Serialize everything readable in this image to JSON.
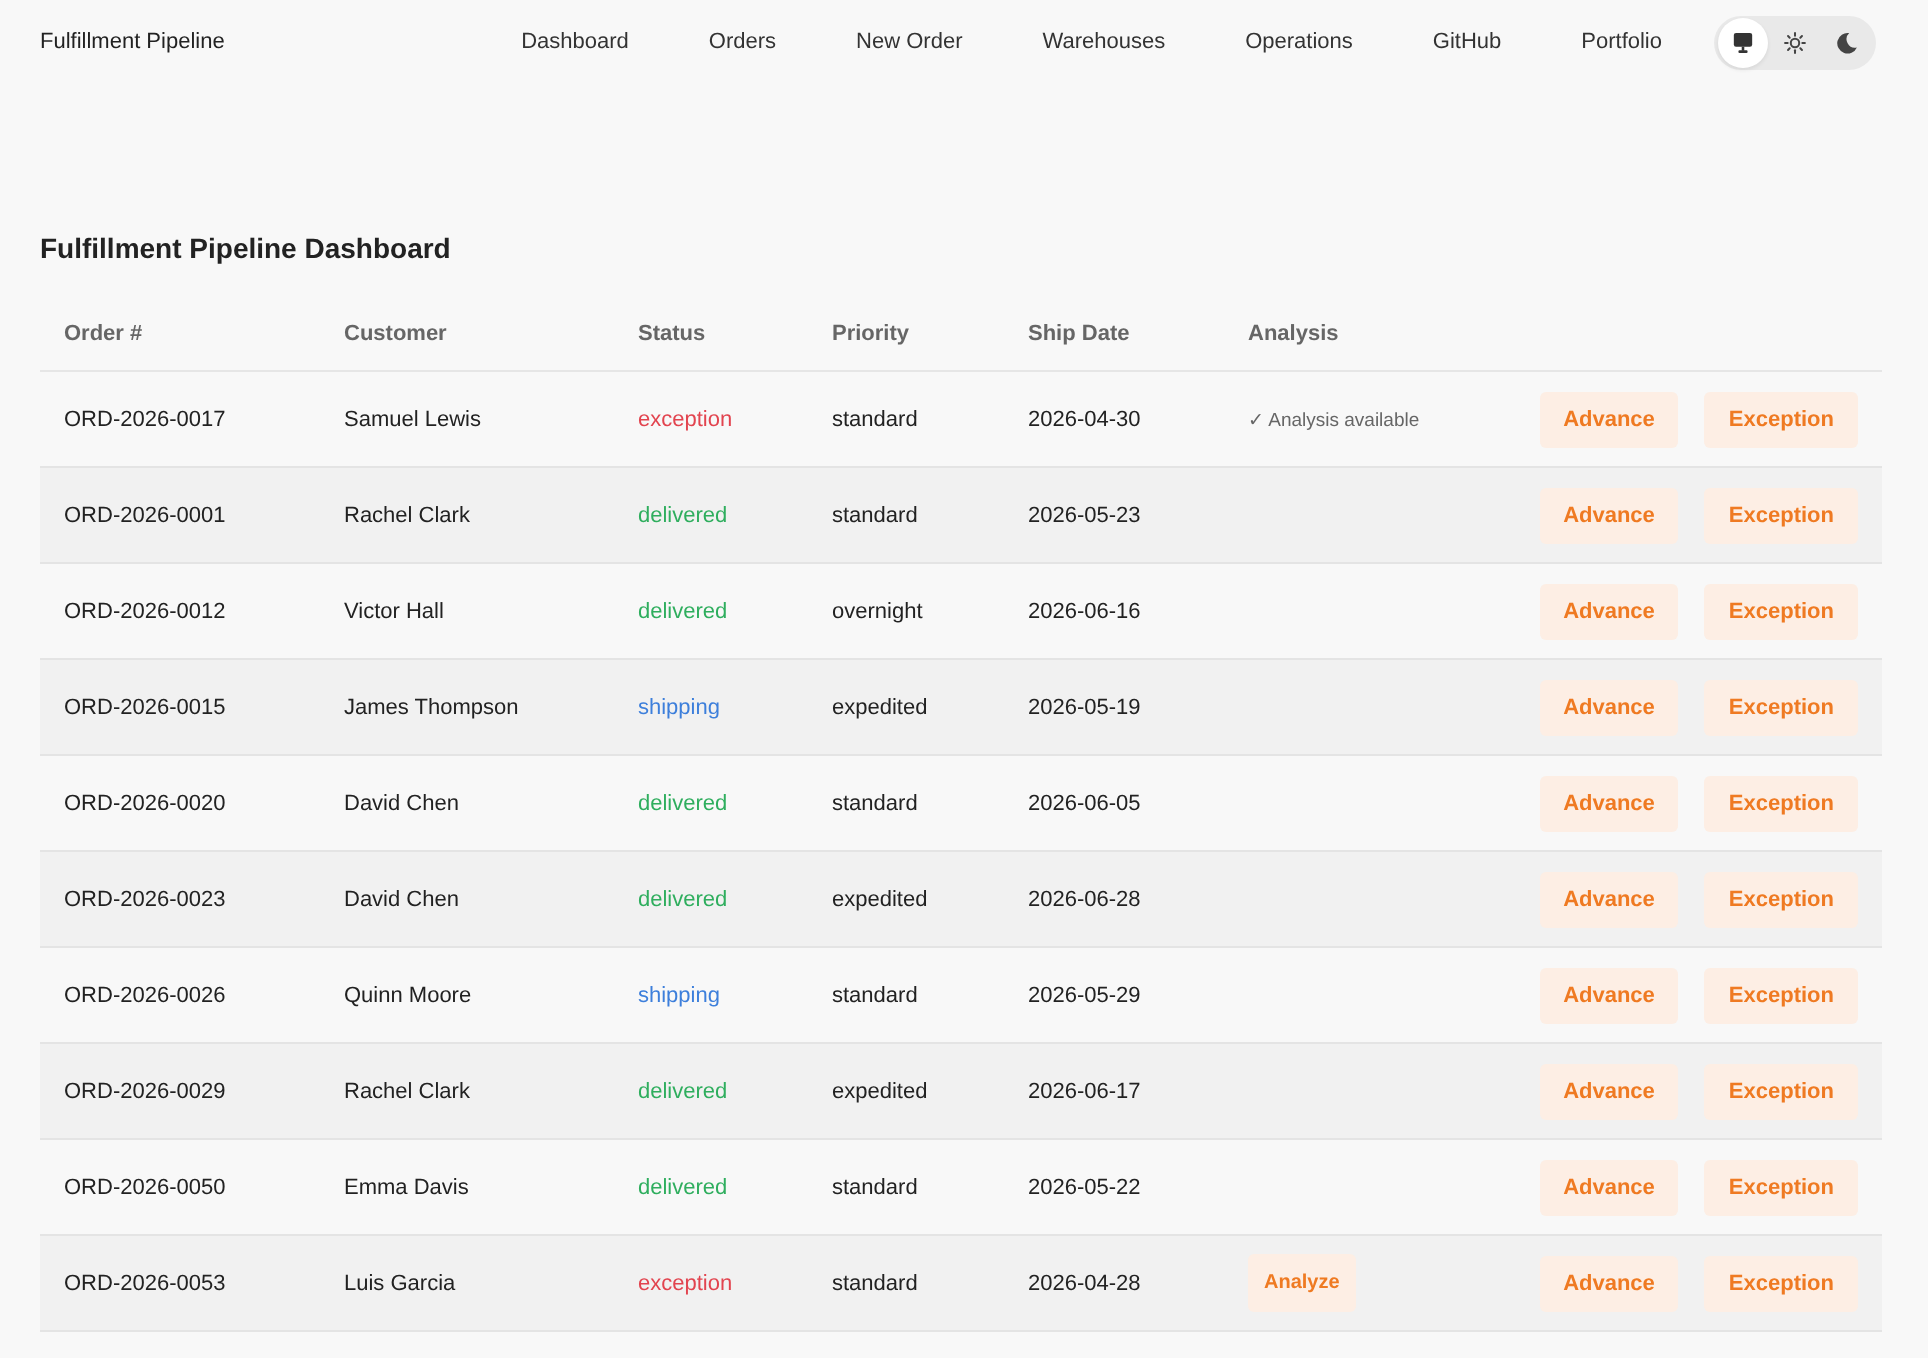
{
  "brand": "Fulfillment Pipeline",
  "nav": [
    "Dashboard",
    "Orders",
    "New Order",
    "Warehouses",
    "Operations",
    "GitHub",
    "Portfolio"
  ],
  "theme_toggle": [
    {
      "kind": "system",
      "selected": true
    },
    {
      "kind": "light",
      "selected": false
    },
    {
      "kind": "dark",
      "selected": false
    }
  ],
  "heading": "Fulfillment Pipeline Dashboard",
  "table": {
    "columns": [
      "Order #",
      "Customer",
      "Status",
      "Priority",
      "Ship Date",
      "Analysis"
    ],
    "rows": [
      {
        "order": "ORD-2026-0017",
        "customer": "Samuel Lewis",
        "status": {
          "text": "exception",
          "color": "#e2444f"
        },
        "priority": "standard",
        "ship_date": "2026-04-30",
        "analysis": {
          "kind": "note",
          "text": "✓ Analysis available"
        },
        "actions": [
          "Advance",
          "Exception"
        ]
      },
      {
        "order": "ORD-2026-0001",
        "customer": "Rachel Clark",
        "status": {
          "text": "delivered",
          "color": "#2fae5e"
        },
        "priority": "standard",
        "ship_date": "2026-05-23",
        "actions": [
          "Advance",
          "Exception"
        ]
      },
      {
        "order": "ORD-2026-0012",
        "customer": "Victor Hall",
        "status": {
          "text": "delivered",
          "color": "#2fae5e"
        },
        "priority": "overnight",
        "ship_date": "2026-06-16",
        "actions": [
          "Advance",
          "Exception"
        ]
      },
      {
        "order": "ORD-2026-0015",
        "customer": "James Thompson",
        "status": {
          "text": "shipping",
          "color": "#3d7fdb"
        },
        "priority": "expedited",
        "ship_date": "2026-05-19",
        "actions": [
          "Advance",
          "Exception"
        ]
      },
      {
        "order": "ORD-2026-0020",
        "customer": "David Chen",
        "status": {
          "text": "delivered",
          "color": "#2fae5e"
        },
        "priority": "standard",
        "ship_date": "2026-06-05",
        "actions": [
          "Advance",
          "Exception"
        ]
      },
      {
        "order": "ORD-2026-0023",
        "customer": "David Chen",
        "status": {
          "text": "delivered",
          "color": "#2fae5e"
        },
        "priority": "expedited",
        "ship_date": "2026-06-28",
        "actions": [
          "Advance",
          "Exception"
        ]
      },
      {
        "order": "ORD-2026-0026",
        "customer": "Quinn Moore",
        "status": {
          "text": "shipping",
          "color": "#3d7fdb"
        },
        "priority": "standard",
        "ship_date": "2026-05-29",
        "actions": [
          "Advance",
          "Exception"
        ]
      },
      {
        "order": "ORD-2026-0029",
        "customer": "Rachel Clark",
        "status": {
          "text": "delivered",
          "color": "#2fae5e"
        },
        "priority": "expedited",
        "ship_date": "2026-06-17",
        "actions": [
          "Advance",
          "Exception"
        ]
      },
      {
        "order": "ORD-2026-0050",
        "customer": "Emma Davis",
        "status": {
          "text": "delivered",
          "color": "#2fae5e"
        },
        "priority": "standard",
        "ship_date": "2026-05-22",
        "actions": [
          "Advance",
          "Exception"
        ]
      },
      {
        "order": "ORD-2026-0053",
        "customer": "Luis Garcia",
        "status": {
          "text": "exception",
          "color": "#e2444f"
        },
        "priority": "standard",
        "ship_date": "2026-04-28",
        "analysis": {
          "kind": "button",
          "text": "Analyze"
        },
        "actions": [
          "Advance",
          "Exception"
        ]
      }
    ]
  }
}
